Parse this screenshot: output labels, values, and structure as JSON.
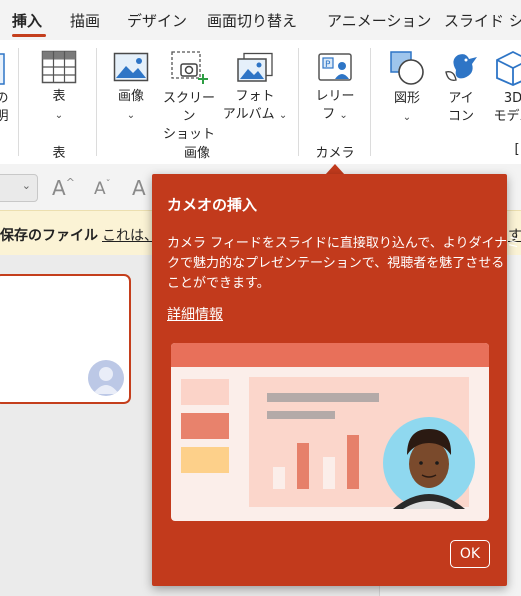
{
  "tabs": {
    "insert": "挿入",
    "draw": "描画",
    "design": "デザイン",
    "transitions": "画面切り替え",
    "animations": "アニメーション",
    "slideshow": "スライド ショ"
  },
  "ribbon": {
    "partial_left_1": "の",
    "partial_left_2": "明",
    "table_button": "表",
    "image_button": "画像",
    "screenshot_line1": "スクリーン",
    "screenshot_line2": "ショット",
    "photo_album_line1": "フォト",
    "photo_album_line2": "アルバム",
    "cameo_line1": "レリー",
    "cameo_line2": "フ",
    "shapes_button": "図形",
    "icons_line1": "アイ",
    "icons_line2": "コン",
    "models_line1": "3D",
    "models_line2": "モデル",
    "groups": {
      "table": "表",
      "images": "画像",
      "camera": "カメラ",
      "illustrations_partial": "["
    }
  },
  "format_row": {
    "increase_font": "A",
    "decrease_font": "A",
    "font_color_a": "A"
  },
  "infobar": {
    "bold_text": "保存のファイル",
    "link_text": "これは、",
    "right_link": "す"
  },
  "callout": {
    "title": "カメオの挿入",
    "body_line1": "カメラ フィードをスライドに直接取り込んで、よりダイナミッ",
    "body_line2": "クで魅力的なプレゼンテーションで、視聴者を魅了させる",
    "body_line3": "ことができます。",
    "link": "詳細情報",
    "ok": "OK"
  },
  "colors": {
    "accent": "#c43e1c",
    "callout_bg": "#c23a1c",
    "infobar_bg": "#fbf3d5"
  }
}
